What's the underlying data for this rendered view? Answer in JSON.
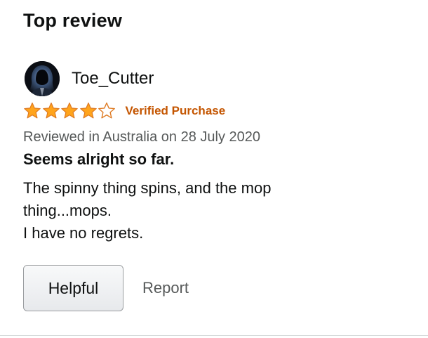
{
  "section": {
    "title": "Top review"
  },
  "review": {
    "username": "Toe_Cutter",
    "avatar_icon": "hooded-figure-avatar",
    "rating": {
      "value": 4,
      "max": 5
    },
    "verified_label": "Verified Purchase",
    "date_line": "Reviewed in Australia on 28 July 2020",
    "title": "Seems alright so far.",
    "body": "The spinny thing spins, and the mop\nthing...mops.\nI have no regrets."
  },
  "actions": {
    "helpful_label": "Helpful",
    "report_label": "Report"
  },
  "colors": {
    "star_fill": "#ffa41c",
    "star_stroke": "#de7921",
    "verified": "#c45500",
    "secondary_text": "#565959"
  }
}
